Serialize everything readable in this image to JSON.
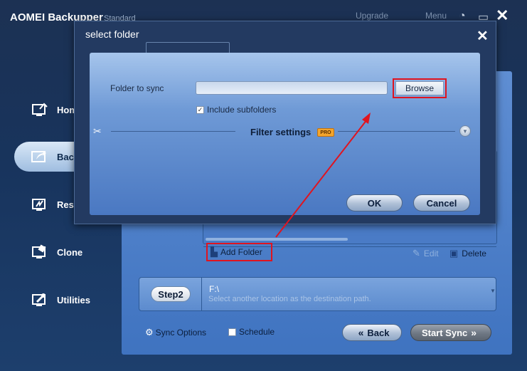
{
  "app": {
    "title": "AOMEI Backupper",
    "edition": "Standard",
    "upgrade_label": "Upgrade",
    "menu_label": "Menu"
  },
  "nav": {
    "items": [
      {
        "label": "Home",
        "icon": "home-icon"
      },
      {
        "label": "Backup",
        "icon": "backup-icon",
        "active": true
      },
      {
        "label": "Restore",
        "icon": "restore-icon"
      },
      {
        "label": "Clone",
        "icon": "clone-icon"
      },
      {
        "label": "Utilities",
        "icon": "utilities-icon"
      }
    ]
  },
  "content": {
    "add_folder_label": "Add Folder",
    "edit_label": "Edit",
    "delete_label": "Delete",
    "step2_label": "Step2",
    "destination_path": "F:\\",
    "destination_hint": "Select another location as the destination path.",
    "sync_options_label": "Sync Options",
    "schedule_label": "Schedule",
    "back_label": "Back",
    "start_sync_label": "Start Sync"
  },
  "dialog": {
    "title": "select folder",
    "folder_label": "Folder to sync",
    "folder_value": "",
    "browse_label": "Browse",
    "include_subfolders_label": "Include subfolders",
    "include_subfolders_checked": true,
    "filter_label": "Filter settings",
    "pro_badge": "PRO",
    "ok_label": "OK",
    "cancel_label": "Cancel"
  },
  "colors": {
    "highlight": "#e0141f",
    "accent": "#4a78c2"
  }
}
